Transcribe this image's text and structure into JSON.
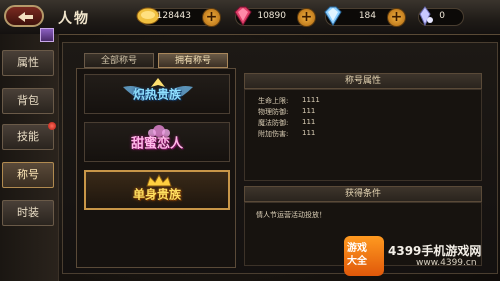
{
  "header": {
    "title": "人物",
    "resources": [
      {
        "name": "gold",
        "value": "128443",
        "color": "#f0c040"
      },
      {
        "name": "ruby",
        "value": "10890",
        "color": "#e0406a"
      },
      {
        "name": "diamond",
        "value": "184",
        "color": "#8fd0ff"
      },
      {
        "name": "crystal",
        "value": "0",
        "color": "#c8c8ff"
      }
    ]
  },
  "sidebar": {
    "items": [
      {
        "label": "属性"
      },
      {
        "label": "背包"
      },
      {
        "label": "技能",
        "badge": true
      },
      {
        "label": "称号",
        "active": true
      },
      {
        "label": "时装"
      }
    ]
  },
  "tabs": [
    {
      "label": "全部称号"
    },
    {
      "label": "拥有称号",
      "active": true
    }
  ],
  "titles": [
    {
      "label": "炽热贵族",
      "color": "#8fe0ff"
    },
    {
      "label": "甜蜜恋人",
      "color": "#ffb8e8"
    },
    {
      "label": "单身贵族",
      "color": "#ffe060",
      "selected": true
    }
  ],
  "attributes": {
    "header": "称号属性",
    "rows": [
      {
        "label": "生命上限:",
        "value": "1111"
      },
      {
        "label": "物理防御:",
        "value": "111"
      },
      {
        "label": "魔法防御:",
        "value": "111"
      },
      {
        "label": "附加伤害:",
        "value": "111"
      }
    ]
  },
  "condition": {
    "header": "获得条件",
    "text": "情人节运营活动投放！"
  },
  "watermark": {
    "logo_line1": "游戏",
    "logo_line2": "大全",
    "site_name": "4399手机游戏网",
    "url": "www.4399.cn"
  }
}
